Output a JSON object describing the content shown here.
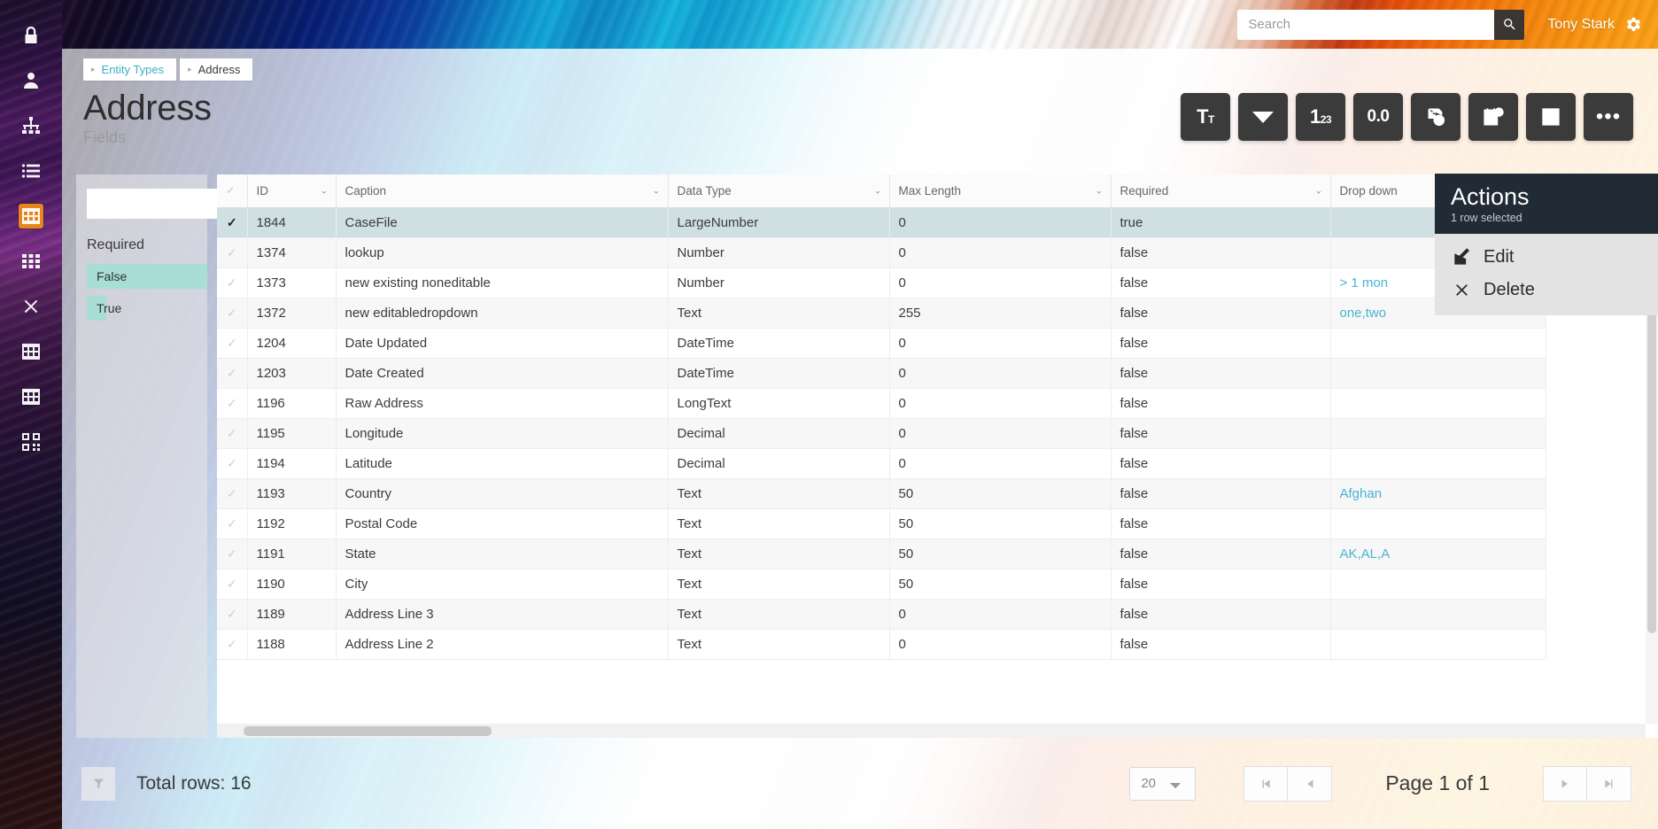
{
  "topbar": {
    "search_placeholder": "Search",
    "search_value": "",
    "search_icon": "search-icon",
    "user_name": "Tony Stark",
    "gear_icon": "gear-icon"
  },
  "sidebar": {
    "items": [
      {
        "name": "lock",
        "icon": "lock-icon",
        "active": false
      },
      {
        "name": "user",
        "icon": "user-icon",
        "active": false
      },
      {
        "name": "organization",
        "icon": "organization-icon",
        "active": false
      },
      {
        "name": "list",
        "icon": "list-icon",
        "active": false
      },
      {
        "name": "entity-types",
        "icon": "table-icon",
        "active": true
      },
      {
        "name": "grid",
        "icon": "grid-icon",
        "active": false
      },
      {
        "name": "close",
        "icon": "x-icon",
        "active": false
      },
      {
        "name": "table-2",
        "icon": "table-icon",
        "active": false
      },
      {
        "name": "table-3",
        "icon": "table-icon",
        "active": false
      },
      {
        "name": "modules",
        "icon": "qr-grid-icon",
        "active": false
      }
    ],
    "active_color": "#e8861e"
  },
  "header": {
    "breadcrumb": [
      {
        "label": "Entity Types",
        "current": false
      },
      {
        "label": "Address",
        "current": true
      }
    ],
    "title": "Address",
    "subtitle": "Fields",
    "link_color": "#3ab0c8"
  },
  "toolbar": {
    "buttons": [
      {
        "name": "text-type",
        "label": "T",
        "sub": "T",
        "icon": "text-type-icon"
      },
      {
        "name": "dropdown-type",
        "label": "",
        "sub": "",
        "icon": "caret-down-icon"
      },
      {
        "name": "number-type",
        "label": "1",
        "sub": "23",
        "icon": "number-type-icon"
      },
      {
        "name": "decimal-type",
        "label": "0.0",
        "sub": "",
        "icon": "decimal-type-icon"
      },
      {
        "name": "largenumber-type",
        "label": "",
        "sub": "",
        "icon": "stack-number-icon"
      },
      {
        "name": "datetime-type",
        "label": "",
        "sub": "",
        "icon": "calendar-clock-icon"
      },
      {
        "name": "boolean-type",
        "label": "",
        "sub": "",
        "icon": "checkbox-icon"
      },
      {
        "name": "more-options",
        "label": "",
        "sub": "",
        "icon": "ellipsis-icon"
      }
    ]
  },
  "facet": {
    "search_value": "",
    "search_placeholder": "",
    "search_icon": "search-icon",
    "title": "Required",
    "items": [
      {
        "label": "False",
        "bar_pct": 100
      },
      {
        "label": "True",
        "bar_pct": 16
      }
    ],
    "bar_color": "#a8ded6"
  },
  "grid": {
    "columns": [
      {
        "key": "chk",
        "label": "",
        "sortable": false
      },
      {
        "key": "id",
        "label": "ID",
        "sortable": true
      },
      {
        "key": "cap",
        "label": "Caption",
        "sortable": true
      },
      {
        "key": "dt",
        "label": "Data Type",
        "sortable": true
      },
      {
        "key": "ml",
        "label": "Max Length",
        "sortable": true
      },
      {
        "key": "req",
        "label": "Required",
        "sortable": true
      },
      {
        "key": "dd",
        "label": "Drop down",
        "sortable": true
      }
    ],
    "rows": [
      {
        "selected": true,
        "id": "1844",
        "cap": "CaseFile",
        "dt": "LargeNumber",
        "ml": "0",
        "req": "true",
        "dd": ""
      },
      {
        "selected": false,
        "id": "1374",
        "cap": "lookup",
        "dt": "Number",
        "ml": "0",
        "req": "false",
        "dd": ""
      },
      {
        "selected": false,
        "id": "1373",
        "cap": "new existing noneditable",
        "dt": "Number",
        "ml": "0",
        "req": "false",
        "dd": "> 1 mon"
      },
      {
        "selected": false,
        "id": "1372",
        "cap": "new editabledropdown",
        "dt": "Text",
        "ml": "255",
        "req": "false",
        "dd": "one,two"
      },
      {
        "selected": false,
        "id": "1204",
        "cap": "Date Updated",
        "dt": "DateTime",
        "ml": "0",
        "req": "false",
        "dd": ""
      },
      {
        "selected": false,
        "id": "1203",
        "cap": "Date Created",
        "dt": "DateTime",
        "ml": "0",
        "req": "false",
        "dd": ""
      },
      {
        "selected": false,
        "id": "1196",
        "cap": "Raw Address",
        "dt": "LongText",
        "ml": "0",
        "req": "false",
        "dd": ""
      },
      {
        "selected": false,
        "id": "1195",
        "cap": "Longitude",
        "dt": "Decimal",
        "ml": "0",
        "req": "false",
        "dd": ""
      },
      {
        "selected": false,
        "id": "1194",
        "cap": "Latitude",
        "dt": "Decimal",
        "ml": "0",
        "req": "false",
        "dd": ""
      },
      {
        "selected": false,
        "id": "1193",
        "cap": "Country",
        "dt": "Text",
        "ml": "50",
        "req": "false",
        "dd": "Afghan"
      },
      {
        "selected": false,
        "id": "1192",
        "cap": "Postal Code",
        "dt": "Text",
        "ml": "50",
        "req": "false",
        "dd": ""
      },
      {
        "selected": false,
        "id": "1191",
        "cap": "State",
        "dt": "Text",
        "ml": "50",
        "req": "false",
        "dd": "AK,AL,A"
      },
      {
        "selected": false,
        "id": "1190",
        "cap": "City",
        "dt": "Text",
        "ml": "50",
        "req": "false",
        "dd": ""
      },
      {
        "selected": false,
        "id": "1189",
        "cap": "Address Line 3",
        "dt": "Text",
        "ml": "0",
        "req": "false",
        "dd": ""
      },
      {
        "selected": false,
        "id": "1188",
        "cap": "Address Line 2",
        "dt": "Text",
        "ml": "0",
        "req": "false",
        "dd": ""
      }
    ],
    "link_color": "#4ab4d0",
    "selected_row_color": "#cfdfe2"
  },
  "actions": {
    "title": "Actions",
    "subtitle": "1 row selected",
    "items": [
      {
        "label": "Edit",
        "icon": "edit-pencil-icon"
      },
      {
        "label": "Delete",
        "icon": "x-icon"
      }
    ]
  },
  "footer": {
    "filter_icon": "funnel-icon",
    "total_rows": "Total rows: 16",
    "page_size": "20",
    "page_size_options": [
      "20"
    ],
    "page_info": "Page 1 of 1",
    "first_icon": "first-page-icon",
    "prev_icon": "prev-page-icon",
    "next_icon": "next-page-icon",
    "last_icon": "last-page-icon"
  }
}
